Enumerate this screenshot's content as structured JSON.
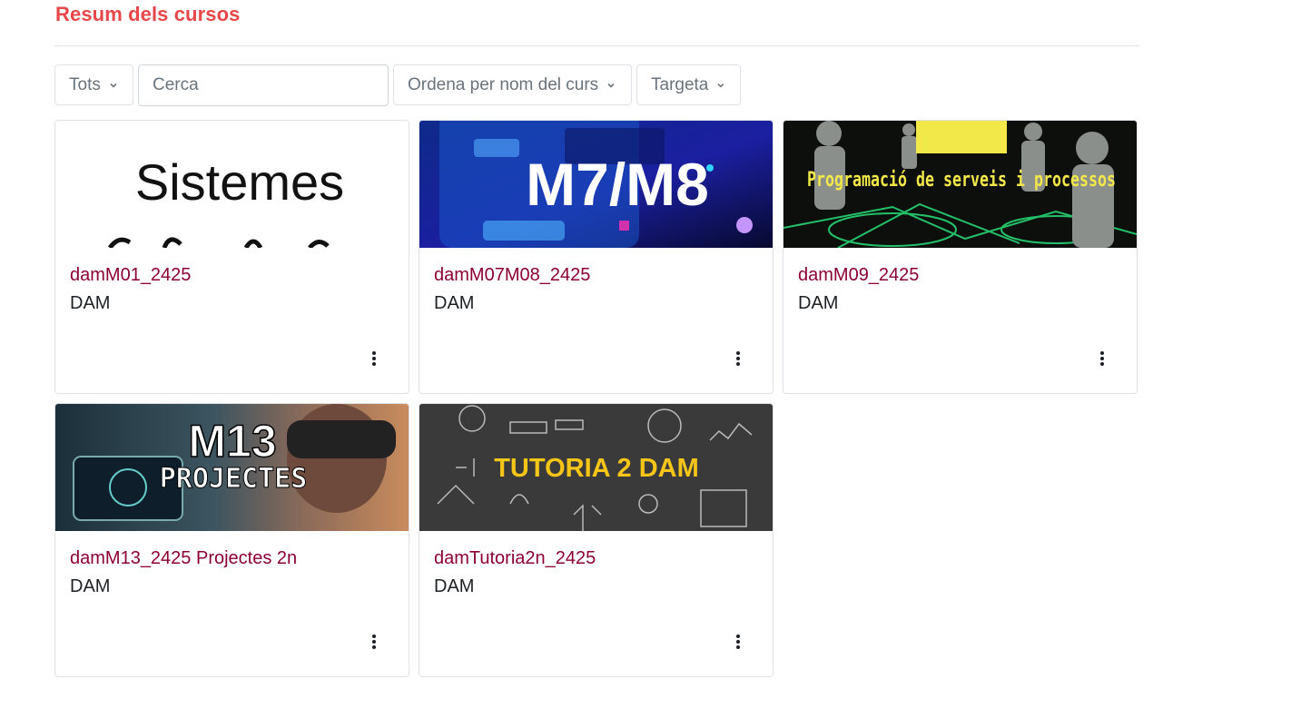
{
  "header": {
    "title": "Resum dels cursos"
  },
  "filters": {
    "grouping": {
      "label": "Tots",
      "icon": "chevron-down-icon"
    },
    "search": {
      "placeholder": "Cerca",
      "value": ""
    },
    "sort": {
      "label": "Ordena per nom del curs",
      "icon": "chevron-down-icon"
    },
    "view": {
      "label": "Targeta",
      "icon": "chevron-down-icon"
    }
  },
  "colors": {
    "title": "#e8474a",
    "course_link": "#8c0033",
    "border": "#dee2e6"
  },
  "courses": [
    {
      "name": "damM01_2425",
      "category": "DAM",
      "image_text": "Sistemes",
      "menu_icon": "kebab-menu-icon"
    },
    {
      "name": "damM07M08_2425",
      "category": "DAM",
      "image_text": "M7/M8",
      "menu_icon": "kebab-menu-icon"
    },
    {
      "name": "damM09_2425",
      "category": "DAM",
      "image_text": "Programació de serveis i processos",
      "menu_icon": "kebab-menu-icon"
    },
    {
      "name": "damM13_2425 Projectes 2n",
      "category": "DAM",
      "image_text": "M13 Projectes",
      "menu_icon": "kebab-menu-icon"
    },
    {
      "name": "damTutoria2n_2425",
      "category": "DAM",
      "image_text": "TUTORIA 2 DAM",
      "menu_icon": "kebab-menu-icon"
    }
  ]
}
